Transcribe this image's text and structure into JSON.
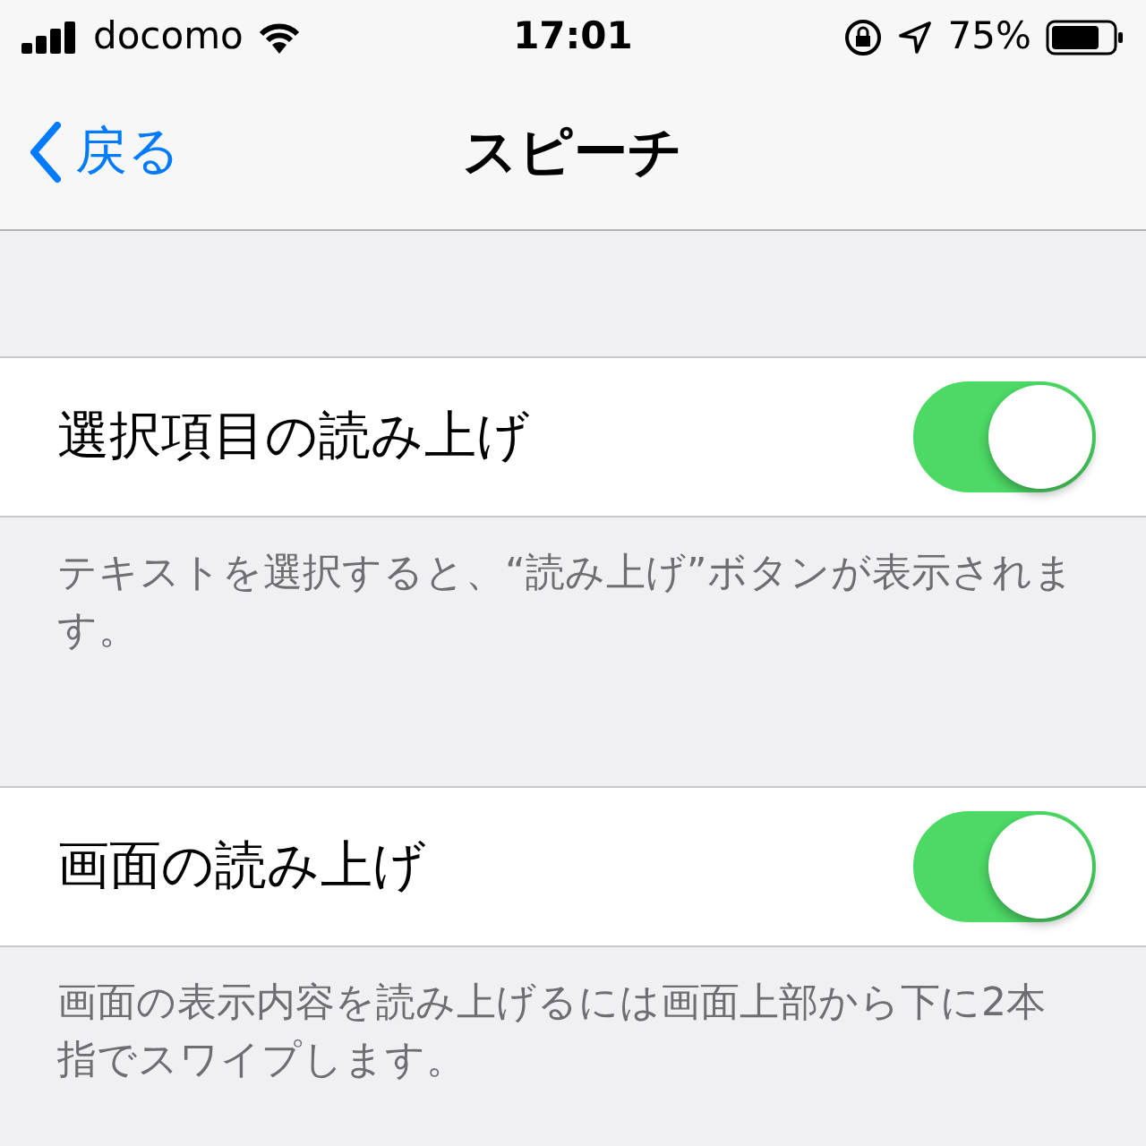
{
  "status_bar": {
    "carrier": "docomo",
    "time": "17:01",
    "battery": "75%"
  },
  "nav": {
    "back": "戻る",
    "title": "スピーチ"
  },
  "sections": [
    {
      "label": "選択項目の読み上げ",
      "on": true,
      "footer": "テキストを選択すると、“読み上げ”ボタンが表示されます。"
    },
    {
      "label": "画面の読み上げ",
      "on": true,
      "footer": "画面の表示内容を読み上げるには画面上部から下に2本指でスワイプします。"
    }
  ]
}
